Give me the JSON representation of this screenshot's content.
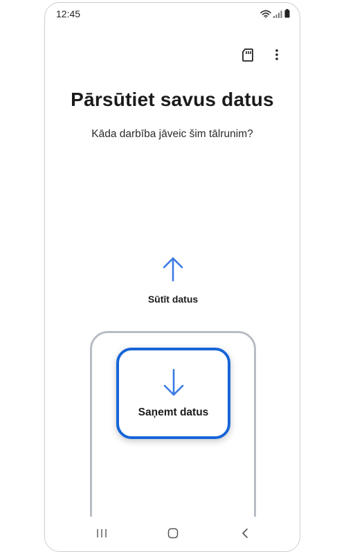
{
  "status_bar": {
    "time": "12:45",
    "icons": [
      "wifi-icon",
      "signal-icon",
      "battery-icon"
    ]
  },
  "toolbar": {
    "icons": [
      "sd-card-icon",
      "more-options-icon"
    ]
  },
  "main": {
    "title": "Pārsūtiet savus datus",
    "subtitle": "Kāda darbība jāveic šim tālrunim?"
  },
  "options": {
    "send": {
      "label": "Sūtīt datus",
      "icon": "arrow-up-icon"
    },
    "receive": {
      "label": "Saņemt datus",
      "icon": "arrow-down-icon",
      "selected": true
    }
  },
  "nav_bar": {
    "icons": [
      "recent-apps-icon",
      "home-icon",
      "back-icon"
    ]
  },
  "colors": {
    "accent": "#1665d8",
    "arrow": "#3b7ae4",
    "frame": "#b8bcc4"
  }
}
